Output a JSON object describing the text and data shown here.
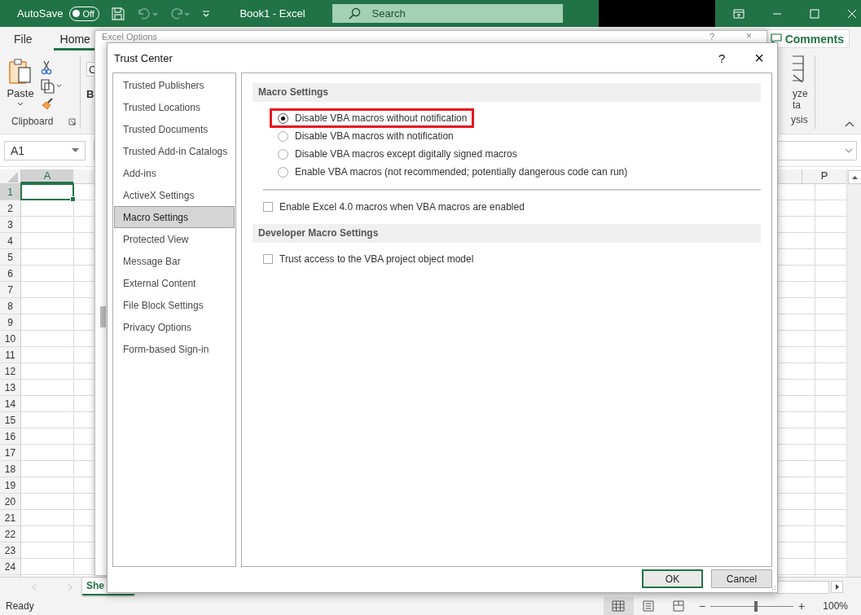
{
  "titlebar": {
    "autosave_label": "AutoSave",
    "autosave_toggle": {
      "label": "Off",
      "on": false
    },
    "title": "Book1  -  Excel",
    "search": {
      "placeholder": "Search"
    }
  },
  "ribbon_tabs": [
    {
      "label": "File",
      "selected": false
    },
    {
      "label": "Home",
      "selected": true
    }
  ],
  "comments_button": "Comments",
  "clipboard_group": {
    "paste_label": "Paste",
    "group_label": "Clipboard"
  },
  "font_group_partial": {
    "font_box": "C",
    "bold": "B"
  },
  "analyze_group_partial": {
    "line_1": "yze",
    "line_2": "ta",
    "group_label": "ysis"
  },
  "name_box": "A1",
  "columns": [
    {
      "label": "A",
      "selected": true
    },
    {
      "label": "P",
      "selected": false
    }
  ],
  "rows": [
    {
      "label": "1",
      "selected": true
    },
    {
      "label": "2",
      "selected": false
    },
    {
      "label": "3",
      "selected": false
    },
    {
      "label": "4",
      "selected": false
    },
    {
      "label": "5",
      "selected": false
    },
    {
      "label": "6",
      "selected": false
    },
    {
      "label": "7",
      "selected": false
    },
    {
      "label": "8",
      "selected": false
    },
    {
      "label": "9",
      "selected": false
    },
    {
      "label": "10",
      "selected": false
    },
    {
      "label": "11",
      "selected": false
    },
    {
      "label": "12",
      "selected": false
    },
    {
      "label": "13",
      "selected": false
    },
    {
      "label": "14",
      "selected": false
    },
    {
      "label": "15",
      "selected": false
    },
    {
      "label": "16",
      "selected": false
    },
    {
      "label": "17",
      "selected": false
    },
    {
      "label": "18",
      "selected": false
    },
    {
      "label": "19",
      "selected": false
    },
    {
      "label": "20",
      "selected": false
    },
    {
      "label": "21",
      "selected": false
    },
    {
      "label": "22",
      "selected": false
    },
    {
      "label": "23",
      "selected": false
    },
    {
      "label": "24",
      "selected": false
    }
  ],
  "sheet_tab": {
    "label": "She",
    "selected": true
  },
  "status_bar": {
    "status": "Ready",
    "zoom_out": "−",
    "zoom_in": "+",
    "zoom": "100%",
    "zoom_slider": {
      "level": 0.55
    }
  },
  "excel_options": {
    "title": "Excel Options",
    "help": "?",
    "close": "×"
  },
  "trust_center": {
    "title": "Trust Center",
    "help": "?",
    "close": "×",
    "nav": [
      {
        "label": "Trusted Publishers",
        "selected": false
      },
      {
        "label": "Trusted Locations",
        "selected": false
      },
      {
        "label": "Trusted Documents",
        "selected": false
      },
      {
        "label": "Trusted Add-in Catalogs",
        "selected": false
      },
      {
        "label": "Add-ins",
        "selected": false
      },
      {
        "label": "ActiveX Settings",
        "selected": false
      },
      {
        "label": "Macro Settings",
        "selected": true
      },
      {
        "label": "Protected View",
        "selected": false
      },
      {
        "label": "Message Bar",
        "selected": false
      },
      {
        "label": "External Content",
        "selected": false
      },
      {
        "label": "File Block Settings",
        "selected": false
      },
      {
        "label": "Privacy Options",
        "selected": false
      },
      {
        "label": "Form-based Sign-in",
        "selected": false
      }
    ],
    "sections": [
      {
        "heading": "Macro Settings",
        "radios": [
          {
            "label": "Disable VBA macros without notification",
            "selected": true,
            "highlighted": true
          },
          {
            "label": "Disable VBA macros with notification",
            "selected": false,
            "highlighted": false
          },
          {
            "label": "Disable VBA macros except digitally signed macros",
            "selected": false,
            "highlighted": false
          },
          {
            "label": "Enable VBA macros (not recommended; potentially dangerous code can run)",
            "selected": false,
            "highlighted": false
          }
        ],
        "checkboxes": [
          {
            "label": "Enable Excel 4.0 macros when VBA macros are enabled",
            "checked": false
          }
        ]
      },
      {
        "heading": "Developer Macro Settings",
        "checkboxes": [
          {
            "label": "Trust access to the VBA project object model",
            "checked": false
          }
        ]
      }
    ],
    "buttons": [
      {
        "label": "OK",
        "default": true
      },
      {
        "label": "Cancel",
        "default": false
      }
    ]
  }
}
